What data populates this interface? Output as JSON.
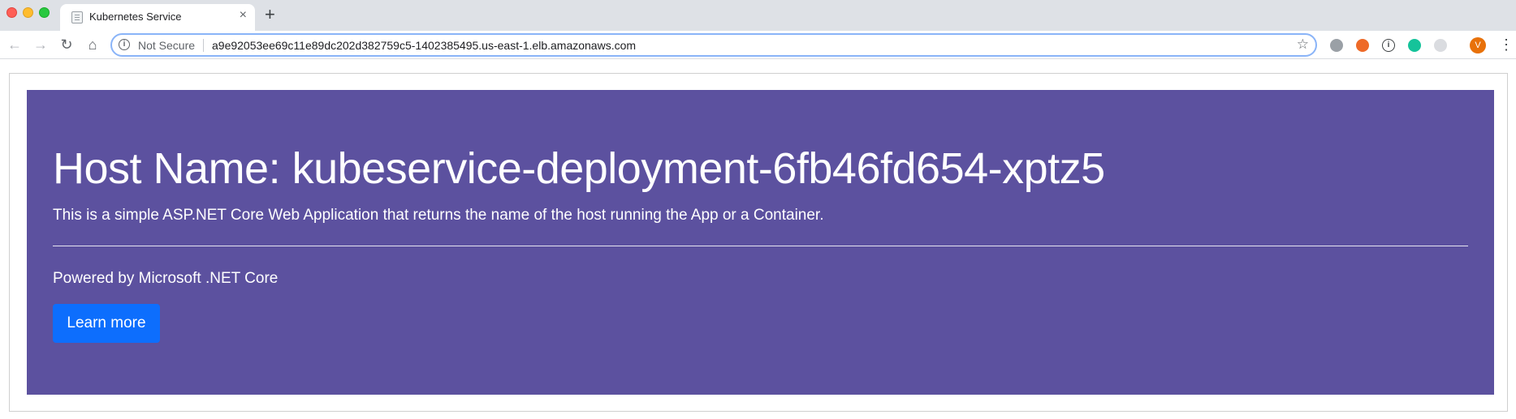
{
  "browser": {
    "tab_title": "Kubernetes Service",
    "tab_close": "×",
    "new_tab": "+",
    "omnibox": {
      "security_label": "Not Secure",
      "url": "a9e92053ee69c11e89dc202d382759c5-1402385495.us-east-1.elb.amazonaws.com"
    },
    "nav": {
      "back": "←",
      "forward": "→",
      "reload": "↻",
      "home": "⌂"
    },
    "extensions": [
      "",
      "",
      "i",
      "",
      ""
    ],
    "profile_initial": "V",
    "icons": {
      "favicon": "document-icon",
      "info": "info-icon",
      "bookmark": "star-icon",
      "menu": "kebab-menu-icon"
    },
    "accent_color": "#8ab4f8"
  },
  "page": {
    "heading": "Host Name: kubeservice-deployment-6fb46fd654-xptz5",
    "lead": "This is a simple ASP.NET Core Web Application that returns the name of the host running the App or a Container.",
    "powered_by": "Powered by Microsoft .NET Core",
    "learn_more_label": "Learn more",
    "colors": {
      "jumbotron_bg": "#5c519f",
      "button_bg": "#0d6efd",
      "text": "#ffffff"
    }
  }
}
